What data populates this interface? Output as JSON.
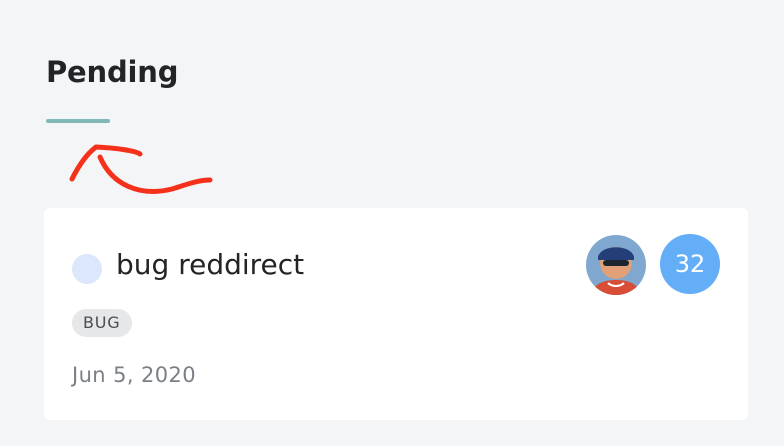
{
  "section": {
    "title": "Pending"
  },
  "card": {
    "title": "bug reddirect",
    "tag": "BUG",
    "date": "Jun 5, 2020",
    "count": "32",
    "avatar": "user-avatar-photo",
    "status_icon": "status-circle-icon"
  },
  "annotation": {
    "icon": "hand-drawn-arrow-icon",
    "color": "#f5311b"
  },
  "colors": {
    "background": "#f4f5f7",
    "accent_underline": "#7fb8b7",
    "status_dot": "#dde7fb",
    "badge": "#64aef7",
    "tag_background": "#e6e7e9",
    "card": "#ffffff"
  }
}
